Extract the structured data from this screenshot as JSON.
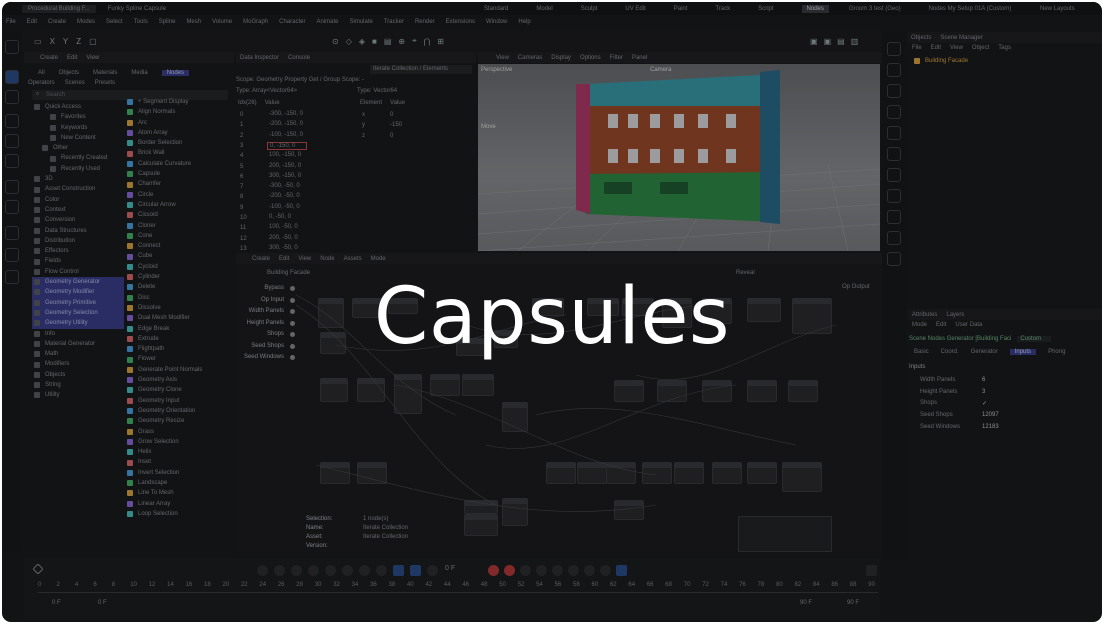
{
  "window": {
    "tabs": [
      "Procedural Building F...",
      "Funky Spline Capsule"
    ],
    "layout_tabs": [
      "Standard",
      "Model",
      "Sculpt",
      "UV Edit",
      "Paint",
      "Track",
      "Script",
      "Nodes",
      "Groom 3 test (Geo)",
      "Nodes My Setup 01A (Custom)"
    ],
    "new_layouts": "New Layouts"
  },
  "menu": [
    "File",
    "Edit",
    "Create",
    "Modes",
    "Select",
    "Tools",
    "Spline",
    "Mesh",
    "Volume",
    "MoGraph",
    "Character",
    "Animate",
    "Simulate",
    "Tracker",
    "Render",
    "Extensions",
    "Window",
    "Help"
  ],
  "assets": {
    "header": [
      "Create",
      "Edit",
      "View"
    ],
    "filters": [
      "All",
      "Objects",
      "Materials",
      "Media",
      "Nodes"
    ],
    "subfilters": [
      "Operators",
      "Scenes",
      "Presets"
    ],
    "search_placeholder": "Search",
    "tree": [
      "Quick Access",
      "Favorites",
      "Keywords",
      "New Content",
      "Other",
      "Recently Created",
      "Recently Used",
      "3D",
      "Asset Construction",
      "Color",
      "Context",
      "Conversion",
      "Data Structures",
      "Distribution",
      "Effectors",
      "Fields",
      "Flow Control",
      "Geometry Generator",
      "Geometry Modifier",
      "Geometry Primitive",
      "Geometry Selection",
      "Geometry Utility",
      "Info",
      "Material Generator",
      "Math",
      "Modifiers",
      "Objects",
      "String",
      "Utility"
    ],
    "items": [
      "+ Segment Display",
      "Align Normals",
      "Arc",
      "Atom Array",
      "Border Selection",
      "Brick Wall",
      "Calculate Curvature",
      "Capsule",
      "Chamfer",
      "Circle",
      "Circular Arrow",
      "Cissoid",
      "Cloner",
      "Cone",
      "Connect",
      "Cube",
      "Cycloid",
      "Cylinder",
      "Delete",
      "Disc",
      "Dissolve",
      "Dual Mesh Modifier",
      "Edge Break",
      "Extrude",
      "Flightpath",
      "Flower",
      "Generate Point Normals",
      "Geometry Axis",
      "Geometry Clone",
      "Geometry Input",
      "Geometry Orientation",
      "Geometry Resize",
      "Grass",
      "Grow Selection",
      "Helix",
      "Inset",
      "Invert Selection",
      "Landscape",
      "Line To Mesh",
      "Linear Array",
      "Loop Selection"
    ]
  },
  "inspector": {
    "tabs": [
      "Data Inspector",
      "Console"
    ],
    "dropdown": "Iterate Collection / Elements",
    "scope": "Scope: Geometry Property Get / Group  Scope: -",
    "type_left": "Type: Array<Vector64>",
    "type_right": "Type: Vector64",
    "cols_left": [
      "Idx(26)",
      "Value"
    ],
    "cols_right": [
      "Element",
      "Value"
    ],
    "rows": [
      [
        "0",
        "-300, -150, 0"
      ],
      [
        "1",
        "-200, -150, 0"
      ],
      [
        "2",
        "-100, -150, 0"
      ],
      [
        "3",
        "0, -150, 0"
      ],
      [
        "4",
        "100, -150, 0"
      ],
      [
        "5",
        "200, -150, 0"
      ],
      [
        "6",
        "300, -150, 0"
      ],
      [
        "7",
        "-300, -50, 0"
      ],
      [
        "8",
        "-200, -50, 0"
      ],
      [
        "9",
        "-100, -50, 0"
      ],
      [
        "10",
        "0, -50, 0"
      ],
      [
        "11",
        "100, -50, 0"
      ],
      [
        "12",
        "200, -50, 0"
      ],
      [
        "13",
        "300, -50, 0"
      ]
    ],
    "elements": [
      [
        "x",
        "0"
      ],
      [
        "y",
        "-150"
      ],
      [
        "z",
        "0"
      ]
    ]
  },
  "viewport": {
    "menu": [
      "View",
      "Cameras",
      "Display",
      "Options",
      "Filter",
      "Panel"
    ],
    "label": "Perspective",
    "camera": "Camera",
    "move": "Move"
  },
  "node_editor": {
    "menu": [
      "Create",
      "Edit",
      "View",
      "Node",
      "Assets",
      "Mode"
    ],
    "path": "Building Facade",
    "reveal": "Reveal",
    "op_output": "Op Output",
    "ports": [
      "Bypass",
      "Op Input",
      "Width Panels",
      "Height Panels",
      "Shops",
      "Seed Shops",
      "Seed Windows"
    ],
    "info": [
      [
        "Selection:",
        "1 node(s)"
      ],
      [
        "Name:",
        "Iterate Collection"
      ],
      [
        "Asset:",
        "Iterate Collection"
      ],
      [
        "Version:",
        ""
      ]
    ]
  },
  "objects": {
    "tabs": [
      "Objects",
      "Scene Manager"
    ],
    "menu": [
      "File",
      "Edit",
      "View",
      "Object",
      "Tags"
    ],
    "item": "Building Facade"
  },
  "attributes": {
    "tabs": [
      "Attributes",
      "Layers"
    ],
    "menu": [
      "Mode",
      "Edit",
      "User Data"
    ],
    "node": "Scene Nodes Generator [Building Faci",
    "preset": "Custom",
    "subtabs": [
      "Basic",
      "Coord.",
      "Generator",
      "Inputs",
      "Phong"
    ],
    "section": "Inputs",
    "fields": [
      [
        "Width Panels",
        "6"
      ],
      [
        "Height Panels",
        "3"
      ],
      [
        "Shops",
        "✓"
      ],
      [
        "Seed Shops",
        "12097"
      ],
      [
        "Seed Windows",
        "12183"
      ]
    ]
  },
  "timeline": {
    "ticks": [
      "0",
      "2",
      "4",
      "6",
      "8",
      "10",
      "12",
      "14",
      "16",
      "18",
      "20",
      "22",
      "24",
      "26",
      "28",
      "30",
      "32",
      "34",
      "36",
      "38",
      "40",
      "42",
      "44",
      "46",
      "48",
      "50",
      "52",
      "54",
      "56",
      "58",
      "60",
      "62",
      "64",
      "66",
      "68",
      "70",
      "72",
      "74",
      "76",
      "78",
      "80",
      "82",
      "84",
      "86",
      "88",
      "90"
    ],
    "start": "0 F",
    "start2": "0 F",
    "end": "90 F",
    "end2": "90 F",
    "current": "0 F"
  },
  "overlay_title": "Capsules"
}
